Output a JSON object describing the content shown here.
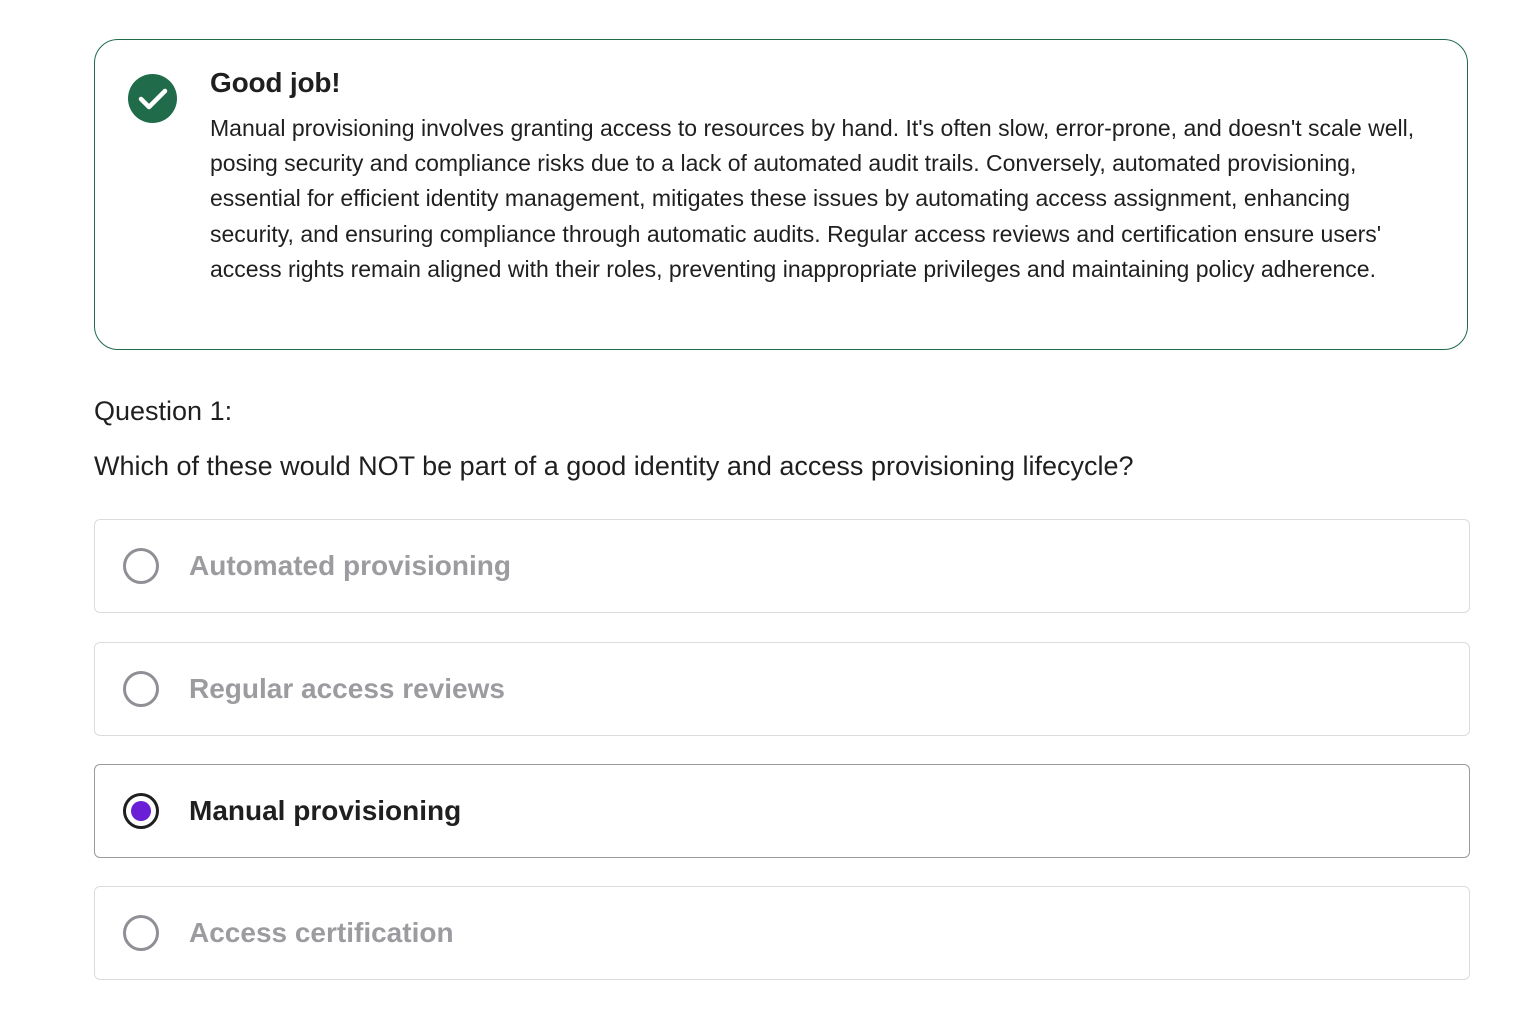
{
  "feedback": {
    "status_icon": "checkmark-circle-icon",
    "accent_color": "#1f6b4a",
    "title": "Good job!",
    "body": "Manual provisioning involves granting access to resources by hand. It's often slow, error-prone, and doesn't scale well, posing security and compliance risks due to a lack of automated audit trails. Conversely, automated provisioning, essential for efficient identity management, mitigates these issues by automating access assignment, enhancing security, and ensuring compliance through automatic audits. Regular access reviews and certification ensure users' access rights remain aligned with their roles, preventing inappropriate privileges and maintaining policy adherence."
  },
  "question": {
    "number_label": "Question 1:",
    "text": "Which of these would NOT be part of a good identity and access provisioning lifecycle?"
  },
  "options": [
    {
      "label": "Automated provisioning",
      "selected": false
    },
    {
      "label": "Regular access reviews",
      "selected": false
    },
    {
      "label": "Manual provisioning",
      "selected": true
    },
    {
      "label": "Access certification",
      "selected": false
    }
  ],
  "selected_radio_color": "#6a1fd6"
}
